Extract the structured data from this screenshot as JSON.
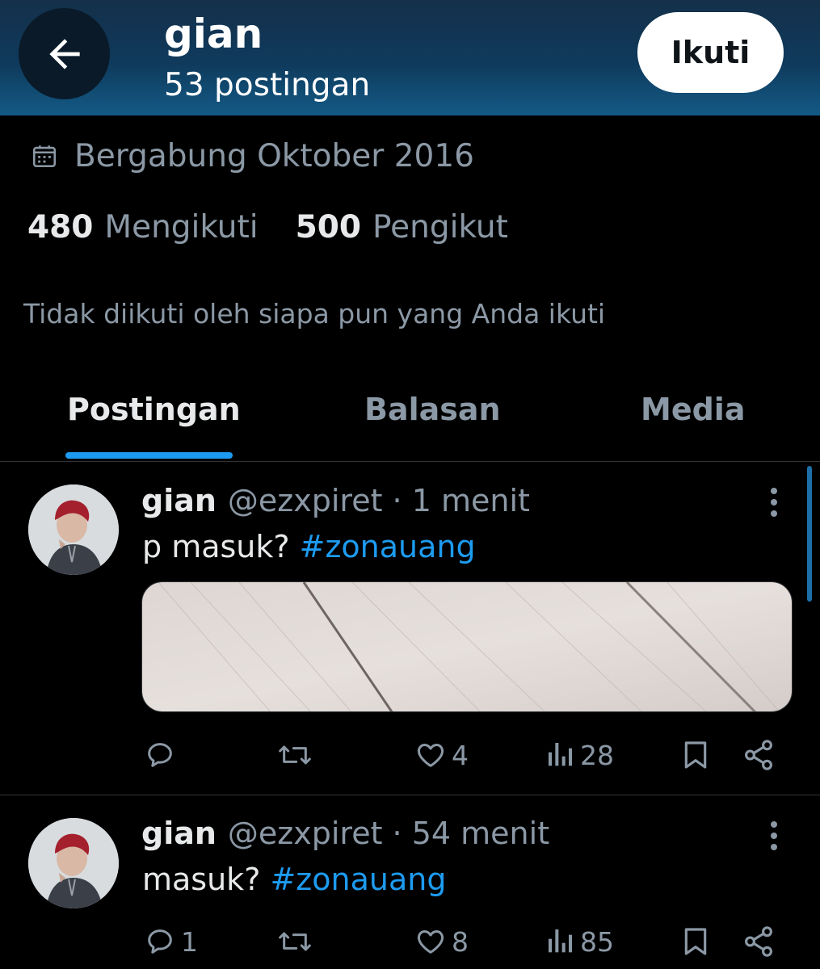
{
  "header": {
    "title": "gian",
    "post_count": "53 postingan",
    "follow_label": "Ikuti"
  },
  "profile": {
    "joined": "Bergabung Oktober 2016",
    "following_count": "480",
    "following_label": "Mengikuti",
    "followers_count": "500",
    "followers_label": "Pengikut",
    "followed_by_note": "Tidak diikuti oleh siapa pun yang Anda ikuti"
  },
  "tabs": [
    {
      "label": "Postingan",
      "active": true
    },
    {
      "label": "Balasan",
      "active": false
    },
    {
      "label": "Media",
      "active": false
    }
  ],
  "posts": [
    {
      "name": "gian",
      "handle": "@ezxpiret · 1 menit",
      "text": "p masuk? ",
      "hashtag": "#zonauang",
      "has_media": true,
      "replies": "",
      "reposts": "",
      "likes": "4",
      "views": "28"
    },
    {
      "name": "gian",
      "handle": "@ezxpiret · 54 menit",
      "text": "masuk? ",
      "hashtag": "#zonauang",
      "has_media": false,
      "replies": "1",
      "reposts": "",
      "likes": "8",
      "views": "85"
    }
  ],
  "colors": {
    "accent": "#1d9bf0",
    "background": "#000000",
    "secondary_text": "#8b98a5",
    "header_gradient_top": "#14304a",
    "header_gradient_bottom": "#135a86"
  },
  "icons": {
    "back": "arrow-left-icon",
    "joined": "calendar-icon",
    "reply": "reply-icon",
    "repost": "repost-icon",
    "like": "heart-icon",
    "views": "views-icon",
    "bookmark": "bookmark-icon",
    "share": "share-icon",
    "more": "more-vertical-icon"
  }
}
